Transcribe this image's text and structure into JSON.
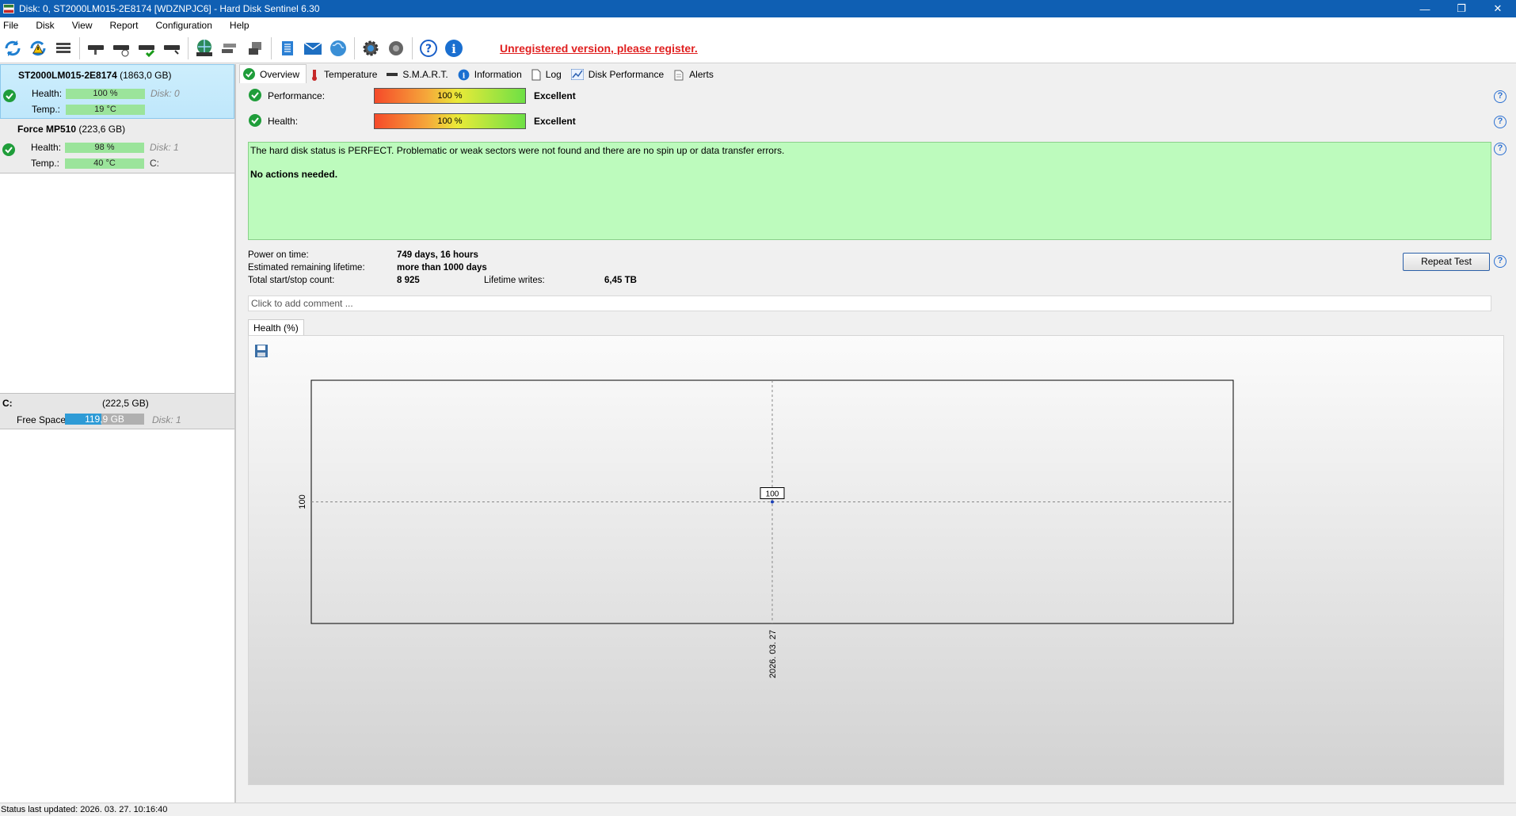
{
  "window": {
    "title": "Disk: 0, ST2000LM015-2E8174 [WDZNPJC6]  -  Hard Disk Sentinel 6.30",
    "buttons": {
      "minimize": "—",
      "restore": "❐",
      "close": "✕"
    }
  },
  "menu": [
    "File",
    "Disk",
    "View",
    "Report",
    "Configuration",
    "Help"
  ],
  "toolbar": {
    "icons": [
      "refresh-icon",
      "refresh-warning-icon",
      "disk-list-icon",
      "disk-icon",
      "disk-clock-icon",
      "disk-check-icon",
      "disk-arrow-icon",
      "globe-disk-icon",
      "disk-network-icon",
      "disk-transfer-icon",
      "report-icon",
      "email-icon",
      "web-report-icon",
      "settings-icon",
      "sound-icon",
      "help-icon",
      "info-icon"
    ],
    "register_link": "Unregistered version, please register."
  },
  "disks": [
    {
      "name": "ST2000LM015-2E8174",
      "size": "(1863,0 GB)",
      "health_label": "Health:",
      "health": "100 %",
      "health_level": 100,
      "disk_label": "Disk: 0",
      "temp_label": "Temp.:",
      "temp": "19 °C",
      "volume": ""
    },
    {
      "name": "Force MP510",
      "size": "(223,6 GB)",
      "health_label": "Health:",
      "health": "98 %",
      "health_level": 98,
      "disk_label": "Disk: 1",
      "temp_label": "Temp.:",
      "temp": "40 °C",
      "volume": "C:"
    }
  ],
  "volume": {
    "letter": "C:",
    "size": "(222,5 GB)",
    "free_label": "Free Space",
    "free": "119,9 GB",
    "used_fraction": 0.46,
    "disk_label": "Disk: 1"
  },
  "tabs": [
    "Overview",
    "Temperature",
    "S.M.A.R.T.",
    "Information",
    "Log",
    "Disk Performance",
    "Alerts"
  ],
  "overview": {
    "performance_label": "Performance:",
    "performance": "100 %",
    "performance_rating": "Excellent",
    "health_label": "Health:",
    "health": "100 %",
    "health_rating": "Excellent",
    "status_text": "The hard disk status is PERFECT. Problematic or weak sectors were not found and there are no spin up or data transfer errors.",
    "status_action": "No actions needed.",
    "power_on_label": "Power on time:",
    "power_on": "749 days, 16 hours",
    "lifetime_label": "Estimated remaining lifetime:",
    "lifetime": "more than 1000 days",
    "startstop_label": "Total start/stop count:",
    "startstop": "8 925",
    "writes_label": "Lifetime writes:",
    "writes": "6,45 TB",
    "repeat_test": "Repeat Test",
    "comment_placeholder": "Click to add comment ...",
    "chart_tab": "Health (%)"
  },
  "chart_data": {
    "type": "line",
    "x": [
      "2026. 03. 27"
    ],
    "series": [
      {
        "values": [
          100
        ]
      }
    ],
    "ytick": "100",
    "xtick": "2026. 03. 27",
    "point_label": "100",
    "grid": true
  },
  "statusbar": {
    "text": "Status last updated: 2026. 03. 27. 10:16:40"
  },
  "colors": {
    "titlebar": "#0f5fb3",
    "status_ok": "#bdfbbd",
    "health_bar": "#9be49b",
    "free_space": "#2e9bd6",
    "register": "#e02020"
  }
}
